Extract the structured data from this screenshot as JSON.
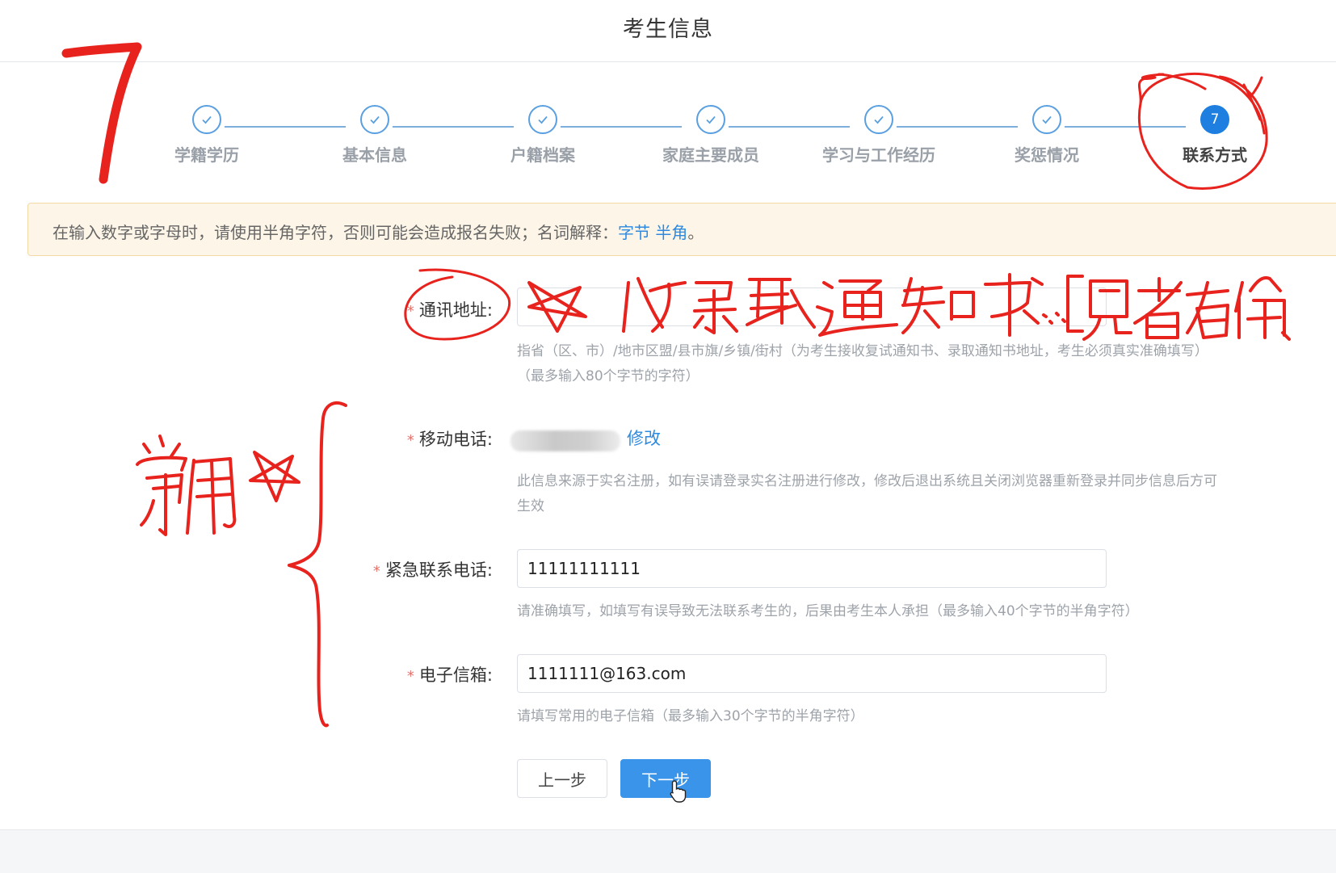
{
  "header": {
    "title": "考生信息"
  },
  "steps": [
    {
      "label": "学籍学历",
      "status": "done"
    },
    {
      "label": "基本信息",
      "status": "done"
    },
    {
      "label": "户籍档案",
      "status": "done"
    },
    {
      "label": "家庭主要成员",
      "status": "done"
    },
    {
      "label": "学习与工作经历",
      "status": "done"
    },
    {
      "label": "奖惩情况",
      "status": "done"
    },
    {
      "label": "联系方式",
      "status": "active",
      "number": "7"
    }
  ],
  "notice": {
    "text": "在输入数字或字母时，请使用半角字符，否则可能会造成报名失败；名词解释：",
    "link_byte": "字节",
    "link_half": "半角",
    "end": "。"
  },
  "form": {
    "address": {
      "label": "通讯地址:",
      "value": "",
      "hint1": "指省（区、市）/地市区盟/县市旗/乡镇/街村（为考生接收复试通知书、录取通知书地址，考生必须真实准确填写）",
      "hint2": "（最多输入80个字节的字符）"
    },
    "mobile": {
      "label": "移动电话:",
      "edit": "修改",
      "hint1": "此信息来源于实名注册，如有误请登录实名注册进行修改，修改后退出系统且关闭浏览器重新登录并同步信息后方可",
      "hint2": "生效"
    },
    "emergency": {
      "label": "紧急联系电话:",
      "value": "11111111111",
      "hint": "请准确填写，如填写有误导致无法联系考生的，后果由考生本人承担（最多输入40个字节的半角字符）"
    },
    "email": {
      "label": "电子信箱:",
      "value": "1111111@163.com",
      "hint": "请填写常用的电子信箱（最多输入30个字节的半角字符）"
    },
    "required_mark": "*"
  },
  "buttons": {
    "prev": "上一步",
    "next": "下一步"
  },
  "annotation_colors": {
    "ink": "#e8231e"
  }
}
